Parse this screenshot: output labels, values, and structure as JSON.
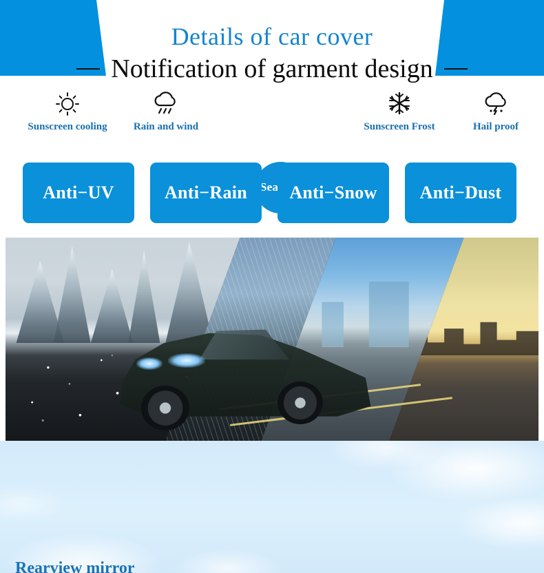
{
  "header": {
    "title": "Details of car cover",
    "banner_color": "#0390DF",
    "title_color": "#1384CE"
  },
  "features": {
    "items": [
      {
        "icon": "sun-icon",
        "label": "Sunscreen cooling"
      },
      {
        "icon": "rain-cloud-icon",
        "label": "Rain and wind"
      },
      {
        "icon": "snowflake-icon",
        "label": "Sunscreen Frost"
      },
      {
        "icon": "hail-cloud-icon",
        "label": "Hail proof"
      }
    ],
    "seasons": {
      "label": "Seasons",
      "prev_arrow": "<",
      "next_arrow": ">",
      "circle_color": "#0D90DA"
    },
    "label_color": "#1A6FAF"
  },
  "buttons": {
    "color": "#0B90DA",
    "text_color": "#FFFFFF",
    "items": [
      {
        "label": "Anti−UV"
      },
      {
        "label": "Anti−Rain"
      },
      {
        "label": "Anti−Snow"
      },
      {
        "label": "Anti−Dust"
      }
    ]
  },
  "photo_band": {
    "panels": [
      {
        "name": "snowy-forest-panel"
      },
      {
        "name": "rainy-road-panel"
      },
      {
        "name": "city-daylight-panel"
      },
      {
        "name": "sunset-city-panel"
      }
    ],
    "subject": "dark green luxury coupe"
  },
  "bottom": {
    "heading": "Notification of garment design",
    "left_dash": "—",
    "right_dash": "—",
    "sub_label": "Rearview mirror",
    "sub_label_color": "#1B72B5",
    "sky_color": "#D6EAFB"
  }
}
